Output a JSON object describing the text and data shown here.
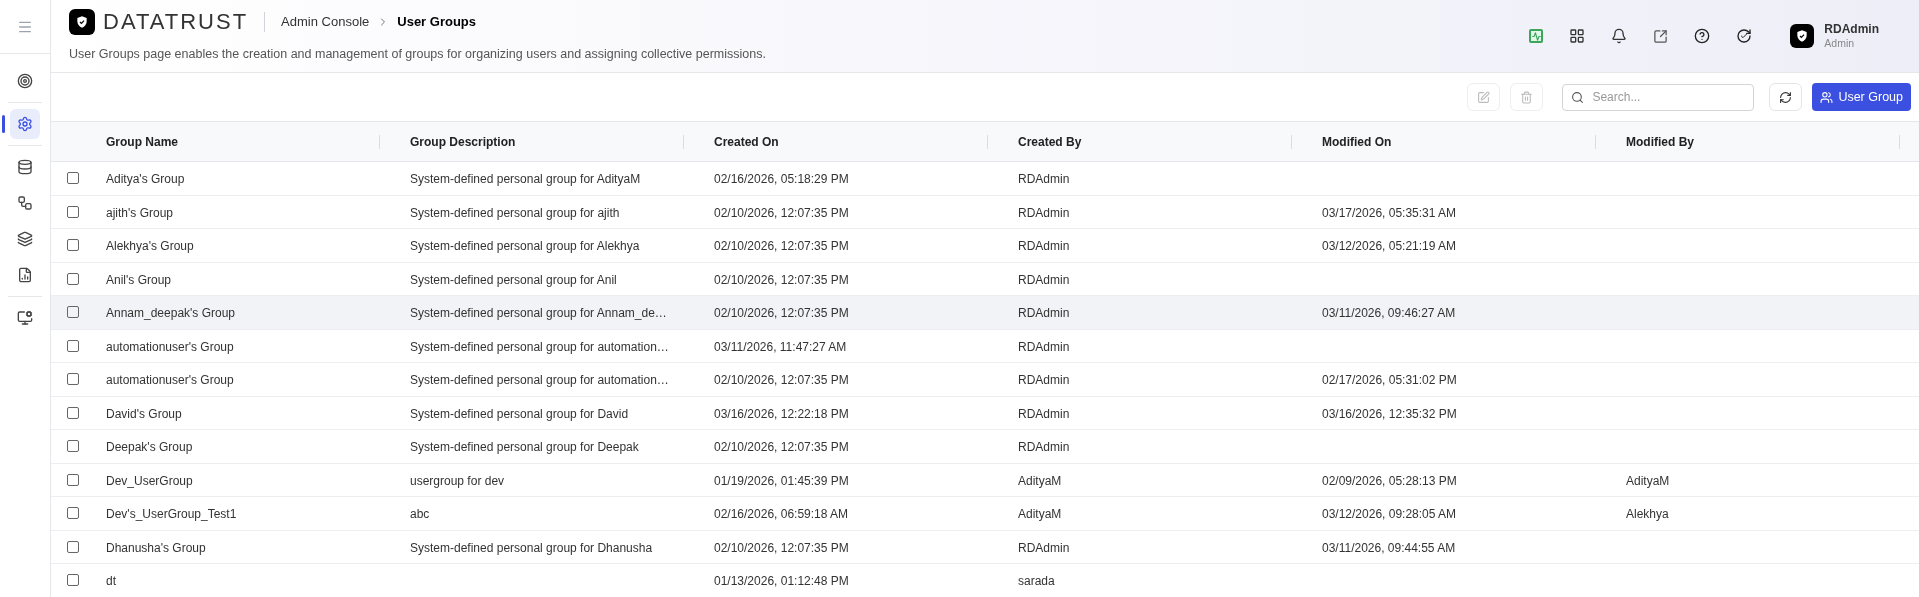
{
  "sidebar": {
    "groups": [
      [
        {
          "kind": "target",
          "selected": false
        }
      ],
      [
        {
          "kind": "settings",
          "selected": true
        }
      ],
      [
        {
          "kind": "database",
          "selected": false
        },
        {
          "kind": "workflow",
          "selected": false
        },
        {
          "kind": "layers",
          "selected": false
        },
        {
          "kind": "report",
          "selected": false
        }
      ],
      [
        {
          "kind": "monitor",
          "selected": false
        }
      ]
    ]
  },
  "header": {
    "brand": "DATATRUST",
    "breadcrumb": [
      {
        "label": "Admin Console",
        "current": false
      },
      {
        "label": "User Groups",
        "current": true
      }
    ],
    "description": "User Groups page enables the creation and management of groups for organizing users and assigning collective permissions.",
    "user": {
      "name": "RDAdmin",
      "role": "Admin"
    }
  },
  "toolbar": {
    "edit_disabled": true,
    "delete_disabled": true,
    "search": {
      "placeholder": "Search..."
    },
    "add_button": "User Group"
  },
  "table": {
    "columns": [
      "Group Name",
      "Group Description",
      "Created On",
      "Created By",
      "Modified On",
      "Modified By"
    ],
    "rows": [
      {
        "checked": false,
        "highlighted": false,
        "cells": [
          "Aditya's Group",
          "System-defined personal group for AdityaM",
          "02/16/2026, 05:18:29 PM",
          "RDAdmin",
          null,
          null
        ]
      },
      {
        "checked": false,
        "highlighted": false,
        "cells": [
          "ajith's Group",
          "System-defined personal group for ajith",
          "02/10/2026, 12:07:35 PM",
          "RDAdmin",
          "03/17/2026, 05:35:31 AM",
          null
        ]
      },
      {
        "checked": false,
        "highlighted": false,
        "cells": [
          "Alekhya's Group",
          "System-defined personal group for Alekhya",
          "02/10/2026, 12:07:35 PM",
          "RDAdmin",
          "03/12/2026, 05:21:19 AM",
          null
        ]
      },
      {
        "checked": false,
        "highlighted": false,
        "cells": [
          "Anil's Group",
          "System-defined personal group for Anil",
          "02/10/2026, 12:07:35 PM",
          "RDAdmin",
          null,
          null
        ]
      },
      {
        "checked": false,
        "highlighted": true,
        "cells": [
          "Annam_deepak's Group",
          "System-defined personal group for Annam_de…",
          "02/10/2026, 12:07:35 PM",
          "RDAdmin",
          "03/11/2026, 09:46:27 AM",
          null
        ]
      },
      {
        "checked": false,
        "highlighted": false,
        "cells": [
          "automationuser's Group",
          "System-defined personal group for automation…",
          "03/11/2026, 11:47:27 AM",
          "RDAdmin",
          null,
          null
        ]
      },
      {
        "checked": false,
        "highlighted": false,
        "cells": [
          "automationuser's Group",
          "System-defined personal group for automation…",
          "02/10/2026, 12:07:35 PM",
          "RDAdmin",
          "02/17/2026, 05:31:02 PM",
          null
        ]
      },
      {
        "checked": false,
        "highlighted": false,
        "cells": [
          "David's Group",
          "System-defined personal group for David",
          "03/16/2026, 12:22:18 PM",
          "RDAdmin",
          "03/16/2026, 12:35:32 PM",
          null
        ]
      },
      {
        "checked": false,
        "highlighted": false,
        "cells": [
          "Deepak's Group",
          "System-defined personal group for Deepak",
          "02/10/2026, 12:07:35 PM",
          "RDAdmin",
          null,
          null
        ]
      },
      {
        "checked": false,
        "highlighted": false,
        "cells": [
          "Dev_UserGroup",
          "usergroup for dev",
          "01/19/2026, 01:45:39 PM",
          "AdityaM",
          "02/09/2026, 05:28:13 PM",
          "AdityaM"
        ]
      },
      {
        "checked": false,
        "highlighted": false,
        "cells": [
          "Dev's_UserGroup_Test1",
          "abc",
          "02/16/2026, 06:59:18 AM",
          "AdityaM",
          "03/12/2026, 09:28:05 AM",
          "Alekhya"
        ]
      },
      {
        "checked": false,
        "highlighted": false,
        "cells": [
          "Dhanusha's Group",
          "System-defined personal group for Dhanusha",
          "02/10/2026, 12:07:35 PM",
          "RDAdmin",
          "03/11/2026, 09:44:55 AM",
          null
        ]
      },
      {
        "checked": false,
        "highlighted": false,
        "cells": [
          "dt",
          null,
          "01/13/2026, 01:12:48 PM",
          "sarada",
          null,
          null
        ]
      }
    ]
  }
}
